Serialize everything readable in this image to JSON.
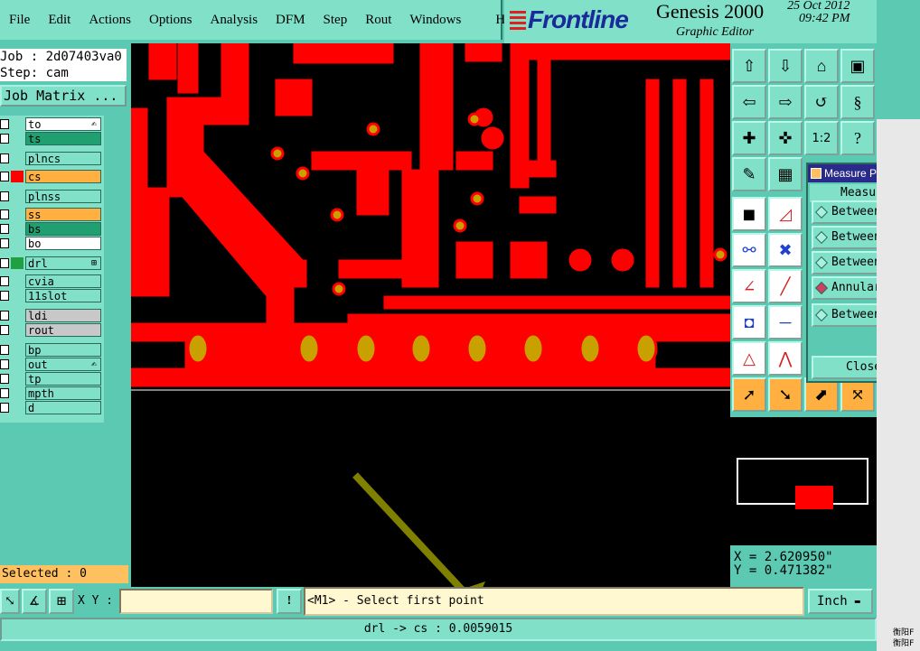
{
  "menu": {
    "items": [
      "File",
      "Edit",
      "Actions",
      "Options",
      "Analysis",
      "DFM",
      "Step",
      "Rout",
      "Windows",
      "Help"
    ]
  },
  "brand": {
    "logo": "Frontline",
    "title": "Genesis 2000",
    "subtitle": "Graphic Editor",
    "date": "25 Oct 2012",
    "time": "09:42 PM"
  },
  "job": {
    "job_label": "Job : 2d07403va0",
    "step_label": "Step: cam",
    "matrix_button": "Job Matrix ..."
  },
  "layers": [
    {
      "name": "to",
      "color": "",
      "name_bg": "#ffffff",
      "mark": "✍"
    },
    {
      "name": "ts",
      "color": "",
      "name_bg": "#20a070",
      "mark": ""
    },
    {
      "name": "plncs",
      "color": "",
      "name_bg": "#80e0c8",
      "mark": ""
    },
    {
      "name": "cs",
      "color": "#ff0000",
      "name_bg": "#ffb040",
      "mark": ""
    },
    {
      "name": "plnss",
      "color": "",
      "name_bg": "#80e0c8",
      "mark": ""
    },
    {
      "name": "ss",
      "color": "",
      "name_bg": "#ffb040",
      "mark": ""
    },
    {
      "name": "bs",
      "color": "",
      "name_bg": "#20a070",
      "mark": ""
    },
    {
      "name": "bo",
      "color": "",
      "name_bg": "#ffffff",
      "mark": ""
    },
    {
      "name": "drl",
      "color": "#20a040",
      "name_bg": "#80e0c8",
      "mark": "⊞"
    },
    {
      "name": "cvia",
      "color": "",
      "name_bg": "#80e0c8",
      "mark": ""
    },
    {
      "name": "11slot",
      "color": "",
      "name_bg": "#80e0c8",
      "mark": ""
    },
    {
      "name": "ldi",
      "color": "",
      "name_bg": "#c8c8c8",
      "mark": ""
    },
    {
      "name": "rout",
      "color": "",
      "name_bg": "#c8c8c8",
      "mark": ""
    },
    {
      "name": "bp",
      "color": "",
      "name_bg": "#80e0c8",
      "mark": ""
    },
    {
      "name": "out",
      "color": "",
      "name_bg": "#80e0c8",
      "mark": "✍"
    },
    {
      "name": "tp",
      "color": "",
      "name_bg": "#80e0c8",
      "mark": ""
    },
    {
      "name": "mpth",
      "color": "",
      "name_bg": "#80e0c8",
      "mark": ""
    },
    {
      "name": "d",
      "color": "",
      "name_bg": "#80e0c8",
      "mark": ""
    }
  ],
  "selected": "Selected : 0",
  "popup": {
    "title": "Measure Popup",
    "header": "Measure Mo",
    "options": [
      "Between Poin",
      "Between Cont",
      "Between Net",
      "Annular Ring",
      "Between Midp"
    ],
    "active_index": 3,
    "close": "Close"
  },
  "coords": {
    "x": "X = 2.620950\"",
    "y": "Y = 0.471382\""
  },
  "cmd": {
    "xy_label": "X Y :",
    "xy_value": "",
    "prompt": "<M1> - Select first point",
    "units": "Inch"
  },
  "status": "drl -> cs : 0.0059015",
  "desktop": {
    "labels": [
      "衡阳F",
      "衡阳F"
    ]
  },
  "colors": {
    "copper": "#ff0000",
    "pad": "#c8a000",
    "arrow": "#808000",
    "panel": "#5cc9b3"
  }
}
